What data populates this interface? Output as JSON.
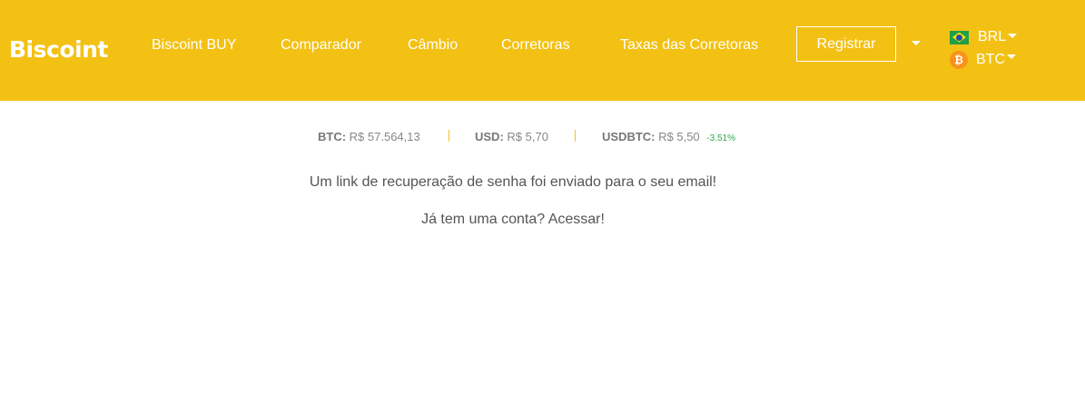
{
  "brand": {
    "name": "Biscoint",
    "color": "#f3c114"
  },
  "nav": {
    "links": [
      "Biscoint BUY",
      "Comparador",
      "Câmbio",
      "Corretoras",
      "Taxas das Corretoras"
    ],
    "register_label": "Registrar"
  },
  "currencies": {
    "fiat": {
      "label": "BRL",
      "icon": "brazil-flag-icon"
    },
    "crypto": {
      "label": "BTC",
      "icon": "bitcoin-icon"
    }
  },
  "ticker": {
    "btc": {
      "label": "BTC:",
      "value": "R$ 57.564,13"
    },
    "usd": {
      "label": "USD:",
      "value": "R$ 5,70"
    },
    "usdbtc": {
      "label": "USDBTC:",
      "value": "R$ 5,50",
      "change": "-3.51%"
    }
  },
  "content": {
    "message": "Um link de recuperação de senha foi enviado para o seu email!",
    "login_prompt": "Já tem uma conta? Acessar!"
  }
}
